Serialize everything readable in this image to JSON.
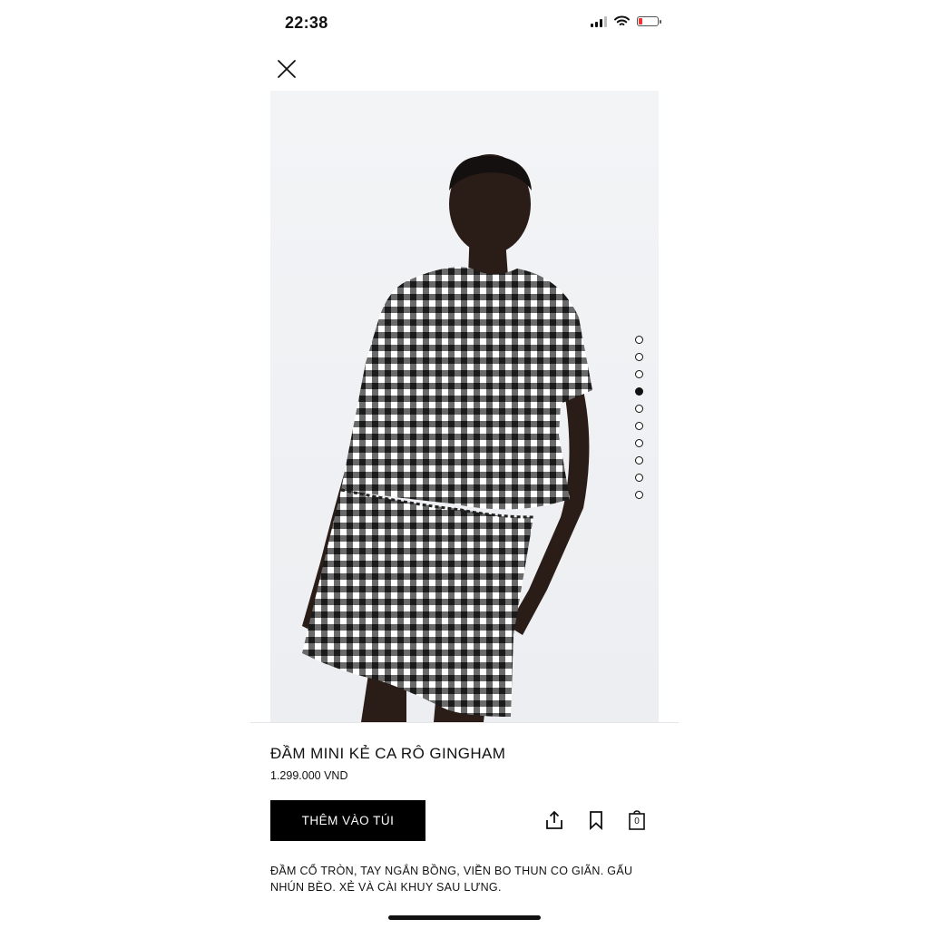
{
  "status_bar": {
    "time": "22:38"
  },
  "product": {
    "title": "ĐẦM MINI KẺ CA RÔ GINGHAM",
    "price": "1.299.000 VND",
    "add_to_bag_label": "THÊM VÀO TÚI",
    "bag_count": "0",
    "description": "ĐẦM CỔ TRÒN, TAY NGẮN BỒNG, VIỀN BO THUN CO GIÃN. GẤU NHÚN BÈO. XẺ VÀ CÀI KHUY SAU LƯNG."
  },
  "gallery": {
    "image_count": 10,
    "active_index": 3
  },
  "icons": {
    "close": "close-icon",
    "share": "share-icon",
    "bookmark": "bookmark-icon",
    "bag": "shopping-bag-icon"
  },
  "colors": {
    "button_bg": "#000000",
    "battery_low": "#e33333"
  }
}
